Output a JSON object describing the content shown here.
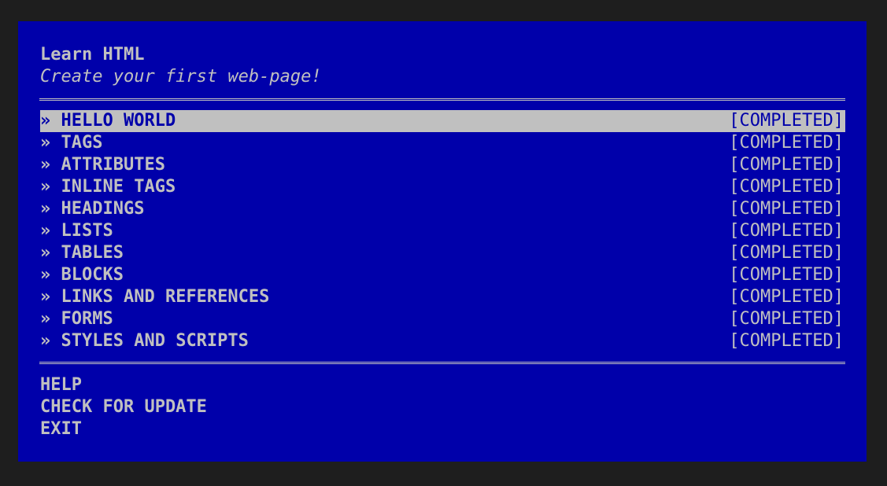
{
  "header": {
    "title": "Learn HTML",
    "subtitle": "Create your first web-page!"
  },
  "menu": {
    "bullet": "»",
    "items": [
      {
        "label": "HELLO WORLD",
        "status": "[COMPLETED]",
        "selected": true
      },
      {
        "label": "TAGS",
        "status": "[COMPLETED]"
      },
      {
        "label": "ATTRIBUTES",
        "status": "[COMPLETED]"
      },
      {
        "label": "INLINE TAGS",
        "status": "[COMPLETED]"
      },
      {
        "label": "HEADINGS",
        "status": "[COMPLETED]"
      },
      {
        "label": "LISTS",
        "status": "[COMPLETED]"
      },
      {
        "label": "TABLES",
        "status": "[COMPLETED]"
      },
      {
        "label": "BLOCKS",
        "status": "[COMPLETED]"
      },
      {
        "label": "LINKS AND REFERENCES",
        "status": "[COMPLETED]"
      },
      {
        "label": "FORMS",
        "status": "[COMPLETED]"
      },
      {
        "label": "STYLES AND SCRIPTS",
        "status": "[COMPLETED]"
      }
    ]
  },
  "footer": {
    "help": "HELP",
    "check_update": "CHECK FOR UPDATE",
    "exit": "EXIT"
  },
  "colors": {
    "background": "#0000aa",
    "foreground": "#c0c0c0",
    "frame": "#1e1e1e"
  }
}
